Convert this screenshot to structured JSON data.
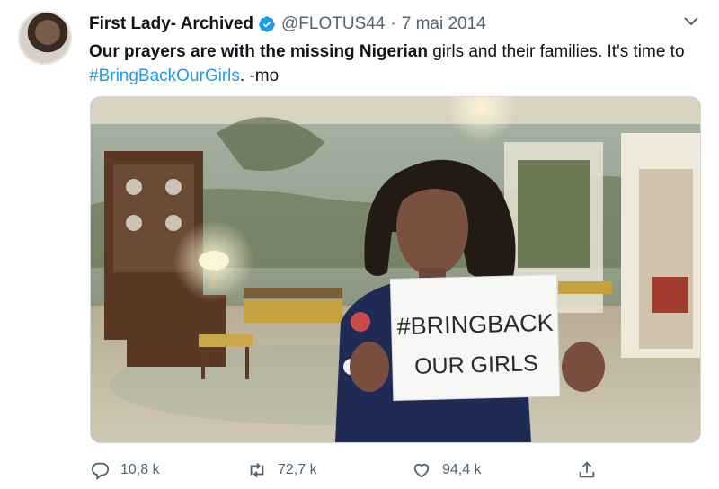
{
  "tweet": {
    "author": {
      "display_name": "First Lady- Archived",
      "handle": "@FLOTUS44",
      "separator": "·",
      "date": "7 mai 2014"
    },
    "text": {
      "bold_part": "Our prayers are with the missing Nigerian",
      "normal_part": " girls and their families. It's time to",
      "hashtag": "#BringBackOurGirls",
      "suffix": ". -mo"
    },
    "media": {
      "sign_line1": "#BRINGBACK",
      "sign_line2": "OUR GIRLS"
    },
    "actions": {
      "replies": "10,8 k",
      "retweets": "72,7 k",
      "likes": "94,4 k"
    }
  },
  "icons": {
    "verified": "verified-badge-icon",
    "menu": "chevron-down-icon",
    "reply": "reply-icon",
    "retweet": "retweet-icon",
    "like": "heart-icon",
    "share": "share-icon"
  },
  "colors": {
    "text": "#0f1419",
    "secondary": "#536471",
    "link": "#1d9bf0",
    "verified": "#1d9bf0"
  }
}
